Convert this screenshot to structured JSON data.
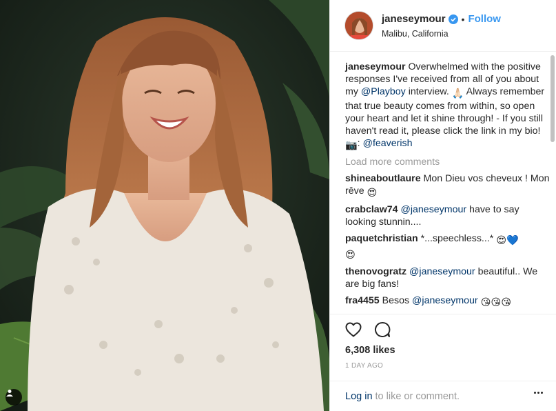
{
  "post": {
    "username": "janeseymour",
    "separator": "•",
    "follow_label": "Follow",
    "location": "Malibu, California",
    "caption": {
      "username": "janeseymour",
      "line1": " Overwhelmed with the positive responses I've received from all of you about my ",
      "mention1": "@Playboy",
      "line2": " interview. ",
      "emoji1": "🙏🏻",
      "line3": " Always remember that true beauty comes from within, so open your heart and let it shine through! - If you still haven't read it, please click the link in my bio! ",
      "camera": "📷",
      "line4": ": ",
      "mention2": "@feaverish"
    },
    "load_more": "Load more comments",
    "comments": [
      {
        "user": "shineaboutlaure",
        "text": " Mon Dieu vos cheveux ! Mon rêve ",
        "emoji": "😍"
      },
      {
        "user": "crabclaw74",
        "mention": "@janeseymour",
        "text": " have to say looking stunnin...."
      },
      {
        "user": "paquetchristian",
        "text": " *...speechless...* ",
        "emoji": "😍💙",
        "emoji2": "😍"
      },
      {
        "user": "thenovogratz",
        "mention": "@janeseymour",
        "text": " beautiful.. We are big fans!"
      },
      {
        "user": "fra4455",
        "text": " Besos ",
        "mention": "@janeseymour",
        "emoji": "😘😘😘"
      }
    ],
    "likes": "6,308 likes",
    "time": "1 DAY AGO",
    "login_link": "Log in",
    "login_rest": "to like or comment."
  },
  "icons": {
    "like": "heart-icon",
    "comment": "comment-bubble-icon",
    "verified": "verified-badge-icon",
    "more": "more-options-icon",
    "tag": "tagged-user-icon"
  },
  "colors": {
    "follow": "#3897f0",
    "mention": "#003569",
    "muted": "#999999",
    "text": "#262626",
    "border": "#efefef"
  }
}
